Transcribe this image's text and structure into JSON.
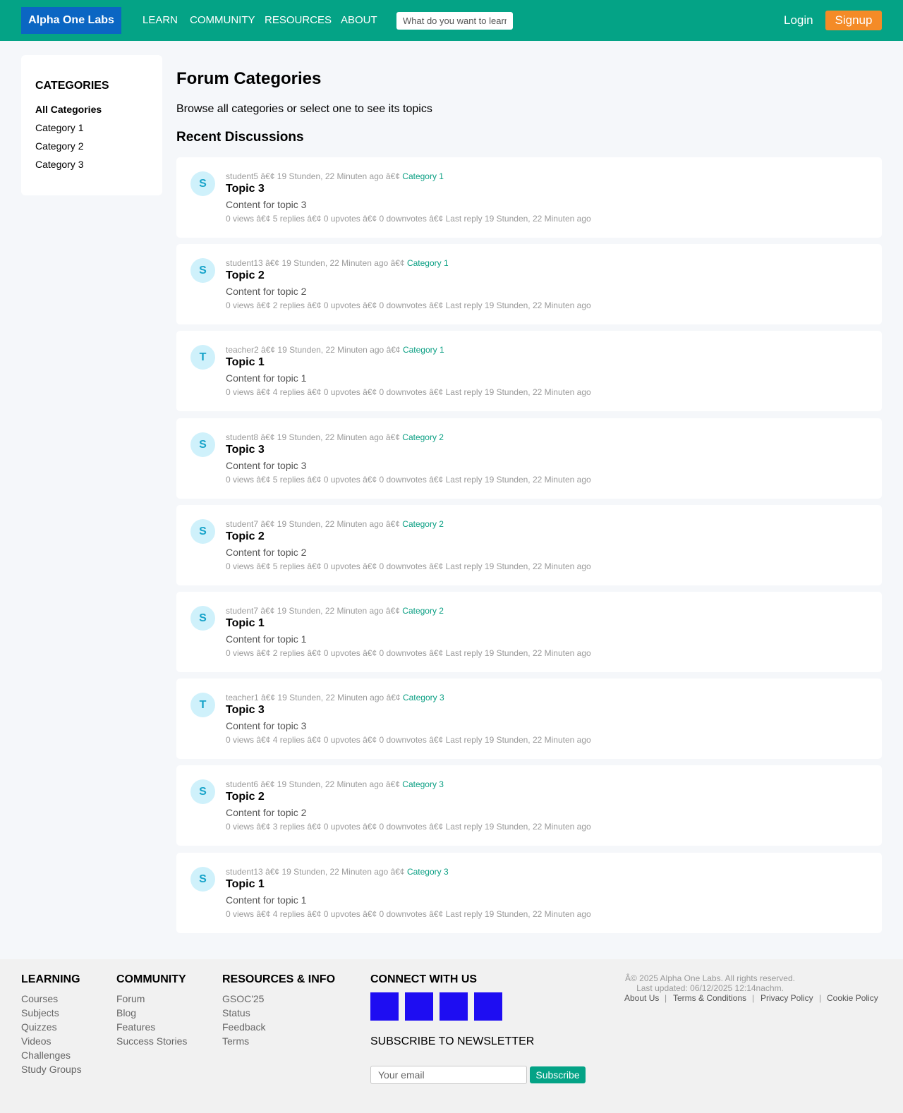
{
  "header": {
    "logo": "Alpha One Labs",
    "nav": [
      "LEARN",
      "COMMUNITY",
      "RESOURCES",
      "ABOUT"
    ],
    "search_placeholder": "What do you want to learn?",
    "login": "Login",
    "signup": "Signup",
    "colors": {
      "bar": "#04a386",
      "logo_bg": "#0b66c3",
      "signup_bg": "#f48b27"
    }
  },
  "sidebar": {
    "title": "CATEGORIES",
    "items": [
      "All Categories",
      "Category 1",
      "Category 2",
      "Category 3"
    ],
    "active_item": "All Categories"
  },
  "main": {
    "title": "Forum Categories",
    "subtitle": "Browse all categories or select one to see its topics",
    "section_title": "Recent Discussions",
    "topics": [
      {
        "initial": "S",
        "author": "student5",
        "time": "19 Stunden, 22 Minuten ago",
        "category": "Category 1",
        "title": "Topic 3",
        "content": "Content for topic 3",
        "stats": "0 views â€¢ 5 replies â€¢ 0 upvotes â€¢ 0 downvotes â€¢ Last reply 19 Stunden, 22 Minuten ago"
      },
      {
        "initial": "S",
        "author": "student13",
        "time": "19 Stunden, 22 Minuten ago",
        "category": "Category 1",
        "title": "Topic 2",
        "content": "Content for topic 2",
        "stats": "0 views â€¢ 2 replies â€¢ 0 upvotes â€¢ 0 downvotes â€¢ Last reply 19 Stunden, 22 Minuten ago"
      },
      {
        "initial": "T",
        "author": "teacher2",
        "time": "19 Stunden, 22 Minuten ago",
        "category": "Category 1",
        "title": "Topic 1",
        "content": "Content for topic 1",
        "stats": "0 views â€¢ 4 replies â€¢ 0 upvotes â€¢ 0 downvotes â€¢ Last reply 19 Stunden, 22 Minuten ago"
      },
      {
        "initial": "S",
        "author": "student8",
        "time": "19 Stunden, 22 Minuten ago",
        "category": "Category 2",
        "title": "Topic 3",
        "content": "Content for topic 3",
        "stats": "0 views â€¢ 5 replies â€¢ 0 upvotes â€¢ 0 downvotes â€¢ Last reply 19 Stunden, 22 Minuten ago"
      },
      {
        "initial": "S",
        "author": "student7",
        "time": "19 Stunden, 22 Minuten ago",
        "category": "Category 2",
        "title": "Topic 2",
        "content": "Content for topic 2",
        "stats": "0 views â€¢ 5 replies â€¢ 0 upvotes â€¢ 0 downvotes â€¢ Last reply 19 Stunden, 22 Minuten ago"
      },
      {
        "initial": "S",
        "author": "student7",
        "time": "19 Stunden, 22 Minuten ago",
        "category": "Category 2",
        "title": "Topic 1",
        "content": "Content for topic 1",
        "stats": "0 views â€¢ 2 replies â€¢ 0 upvotes â€¢ 0 downvotes â€¢ Last reply 19 Stunden, 22 Minuten ago"
      },
      {
        "initial": "T",
        "author": "teacher1",
        "time": "19 Stunden, 22 Minuten ago",
        "category": "Category 3",
        "title": "Topic 3",
        "content": "Content for topic 3",
        "stats": "0 views â€¢ 4 replies â€¢ 0 upvotes â€¢ 0 downvotes â€¢ Last reply 19 Stunden, 22 Minuten ago"
      },
      {
        "initial": "S",
        "author": "student6",
        "time": "19 Stunden, 22 Minuten ago",
        "category": "Category 3",
        "title": "Topic 2",
        "content": "Content for topic 2",
        "stats": "0 views â€¢ 3 replies â€¢ 0 upvotes â€¢ 0 downvotes â€¢ Last reply 19 Stunden, 22 Minuten ago"
      },
      {
        "initial": "S",
        "author": "student13",
        "time": "19 Stunden, 22 Minuten ago",
        "category": "Category 3",
        "title": "Topic 1",
        "content": "Content for topic 1",
        "stats": "0 views â€¢ 4 replies â€¢ 0 upvotes â€¢ 0 downvotes â€¢ Last reply 19 Stunden, 22 Minuten ago"
      }
    ],
    "meta_separator": "â€¢",
    "colors": {
      "category_link": "#0a9f83",
      "avatar_bg": "#cff1fb",
      "avatar_text": "#16a3c9"
    }
  },
  "footer": {
    "learning": {
      "heading": "LEARNING",
      "links": [
        "Courses",
        "Subjects",
        "Quizzes",
        "Videos",
        "Challenges",
        "Study Groups"
      ]
    },
    "community": {
      "heading": "COMMUNITY",
      "links": [
        "Forum",
        "Blog",
        "Features",
        "Success Stories"
      ]
    },
    "resources": {
      "heading": "RESOURCES & INFO",
      "links": [
        "GSOC'25",
        "Status",
        "Feedback",
        "Terms"
      ]
    },
    "connect": {
      "heading": "CONNECT WITH US",
      "social_icons": [
        "social-icon-1",
        "social-icon-2",
        "social-icon-3",
        "social-icon-4"
      ],
      "icon_color": "#1e0df2"
    },
    "newsletter": {
      "title": "SUBSCRIBE TO NEWSLETTER",
      "email_placeholder": "Your email",
      "button": "Subscribe"
    },
    "copyright": "Â© 2025 Alpha One Labs. All rights reserved.",
    "last_updated": "Last updated: 06/12/2025 12:14nachm.",
    "legal_links": [
      "About Us",
      "Terms & Conditions",
      "Privacy Policy",
      "Cookie Policy"
    ],
    "legal_separator": "|"
  }
}
